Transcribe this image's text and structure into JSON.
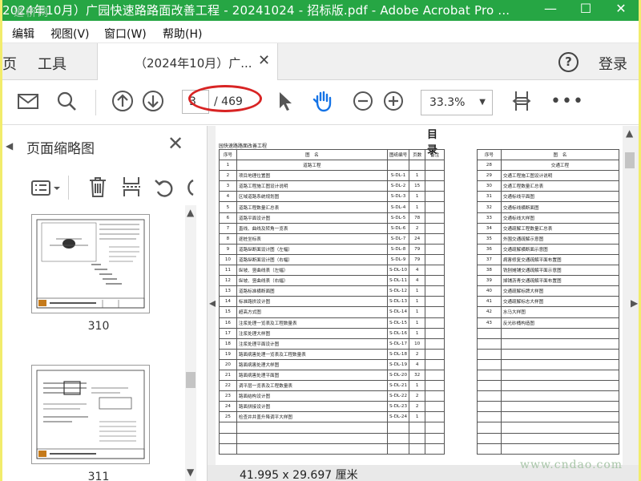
{
  "window": {
    "title": "2024年10月）广园快速路路面改善工程 - 20241024 - 招标版.pdf - Adobe Acrobat Pro ...",
    "watermark": "道桥网",
    "minimize": "—",
    "maximize": "☐",
    "close": "✕"
  },
  "menu": [
    "编辑",
    "视图(V)",
    "窗口(W)",
    "帮助(H)"
  ],
  "tabs": {
    "home": "页",
    "tools": "工具",
    "doc": "（2024年10月）广...",
    "doc_close": "✕"
  },
  "header": {
    "help": "?",
    "login": "登录"
  },
  "toolbar": {
    "page_input": "3",
    "page_count": "/ 469",
    "zoom": "33.3%",
    "zoom_caret": "▼",
    "more": "•••"
  },
  "sidebar": {
    "title": "页面缩略图",
    "close": "✕",
    "thumbnails": [
      "310",
      "311"
    ]
  },
  "document": {
    "heading": "目录",
    "subtitle": "园快速路路面改善工程",
    "left_headers": [
      "序号",
      "图　名",
      "图纸编号",
      "页数",
      "备注"
    ],
    "left_rows": [
      [
        "1",
        "道路工程",
        "",
        "",
        ""
      ],
      [
        "2",
        "项目地理位置图",
        "S-DL-1",
        "1",
        ""
      ],
      [
        "3",
        "道路工程施工图设计说明",
        "S-DL-2",
        "15",
        ""
      ],
      [
        "4",
        "区域道路系统规划图",
        "S-DL-3",
        "1",
        ""
      ],
      [
        "5",
        "道路工程数量汇总表",
        "S-DL-4",
        "1",
        ""
      ],
      [
        "6",
        "道路平面设计图",
        "S-DL-5",
        "78",
        ""
      ],
      [
        "7",
        "直线、曲线及转角一览表",
        "S-DL-6",
        "2",
        ""
      ],
      [
        "8",
        "逐桩坐标表",
        "S-DL-7",
        "24",
        ""
      ],
      [
        "9",
        "道路纵断面设计图（左幅）",
        "S-DL-8",
        "79",
        ""
      ],
      [
        "10",
        "道路纵断面设计图（右幅）",
        "S-DL-9",
        "79",
        ""
      ],
      [
        "11",
        "纵坡、竖曲线表（左幅）",
        "S-DL-10",
        "4",
        ""
      ],
      [
        "12",
        "纵坡、竖曲线表（右幅）",
        "S-DL-11",
        "4",
        ""
      ],
      [
        "13",
        "道路标准横断面图",
        "S-DL-12",
        "1",
        ""
      ],
      [
        "14",
        "标准路拱设计图",
        "S-DL-13",
        "1",
        ""
      ],
      [
        "15",
        "超高方式图",
        "S-DL-14",
        "1",
        ""
      ],
      [
        "16",
        "注浆处理一览表及工程数量表",
        "S-DL-15",
        "1",
        ""
      ],
      [
        "17",
        "注浆处理大样图",
        "S-DL-16",
        "1",
        ""
      ],
      [
        "18",
        "注浆处理平面设计图",
        "S-DL-17",
        "10",
        ""
      ],
      [
        "19",
        "路面病害处理一览表及工程数量表",
        "S-DL-18",
        "2",
        ""
      ],
      [
        "20",
        "路面病害处理大样图",
        "S-DL-19",
        "4",
        ""
      ],
      [
        "21",
        "路面病害处理平面图",
        "S-DL-20",
        "32",
        ""
      ],
      [
        "22",
        "调平层一览表及工程数量表",
        "S-DL-21",
        "1",
        ""
      ],
      [
        "23",
        "路面结构设计图",
        "S-DL-22",
        "2",
        ""
      ],
      [
        "24",
        "路面拼接设计图",
        "S-DL-23",
        "2",
        ""
      ],
      [
        "25",
        "检查井井盖升降调平大样图",
        "S-DL-24",
        "1",
        ""
      ],
      [
        "",
        "",
        "",
        "",
        ""
      ],
      [
        "",
        "",
        "",
        "",
        ""
      ],
      [
        "",
        "",
        "",
        "",
        ""
      ]
    ],
    "right_headers": [
      "序号",
      "图　名"
    ],
    "right_rows": [
      [
        "28",
        "交通工程"
      ],
      [
        "29",
        "交通工程施工图设计说明"
      ],
      [
        "30",
        "交通工程数量汇总表"
      ],
      [
        "31",
        "交通标线平面图"
      ],
      [
        "32",
        "交通标线横断面图"
      ],
      [
        "33",
        "交通标线大样图"
      ],
      [
        "34",
        "交通疏解工程数量汇总表"
      ],
      [
        "35",
        "外围交通疏解示意图"
      ],
      [
        "36",
        "交通疏解横断面示意图"
      ],
      [
        "37",
        "病害修复交通疏解平面布置图"
      ],
      [
        "38",
        "铣刨摊铺交通疏解平面示意图"
      ],
      [
        "39",
        "掉铺沥青交通疏解平面布置图"
      ],
      [
        "40",
        "交通疏解标牌大样图"
      ],
      [
        "41",
        "交通疏解标志大样图"
      ],
      [
        "42",
        "水马大样图"
      ],
      [
        "43",
        "反光砂桶构造图"
      ],
      [
        "",
        ""
      ],
      [
        "",
        ""
      ],
      [
        "",
        ""
      ],
      [
        "",
        ""
      ],
      [
        "",
        ""
      ],
      [
        "",
        ""
      ],
      [
        "",
        ""
      ],
      [
        "",
        ""
      ],
      [
        "",
        ""
      ],
      [
        "",
        ""
      ],
      [
        "",
        ""
      ],
      [
        "",
        ""
      ]
    ]
  },
  "status": {
    "page_size": "41.995 x 29.697 厘米"
  },
  "footer_watermark": "www.cndao.com",
  "colors": {
    "titlebar": "#26a644",
    "highlight": "#d82424",
    "hand_tool": "#1473e6"
  }
}
